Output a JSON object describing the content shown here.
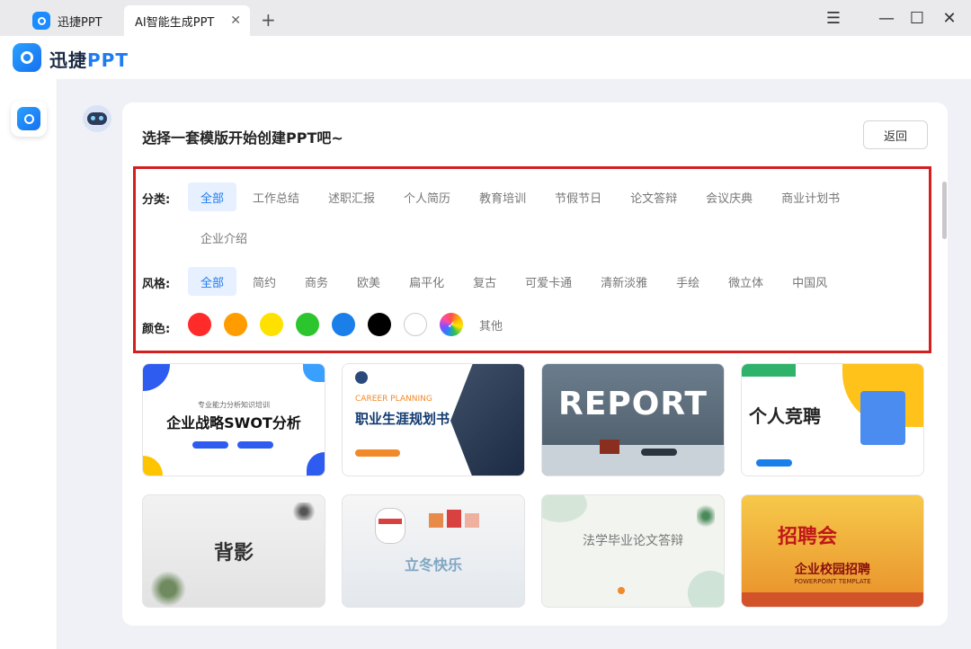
{
  "tabs": [
    {
      "label": "迅捷PPT"
    },
    {
      "label": "AI智能生成PPT"
    }
  ],
  "window_controls": {
    "menu": "☰",
    "minimize": "—",
    "maximize": "☐",
    "close": "✕"
  },
  "brand": {
    "name_prefix": "迅捷",
    "name_accent": "PPT"
  },
  "panel": {
    "title": "选择一套模版开始创建PPT吧~",
    "back_label": "返回"
  },
  "filters": {
    "category_label": "分类:",
    "categories": [
      "全部",
      "工作总结",
      "述职汇报",
      "个人简历",
      "教育培训",
      "节假节日",
      "论文答辩",
      "会议庆典",
      "商业计划书",
      "企业介绍"
    ],
    "style_label": "风格:",
    "styles": [
      "全部",
      "简约",
      "商务",
      "欧美",
      "扁平化",
      "复古",
      "可爱卡通",
      "清新淡雅",
      "手绘",
      "微立体",
      "中国风"
    ],
    "color_label": "颜色:",
    "colors": [
      "#ff2a2a",
      "#ff9d00",
      "#ffe100",
      "#2dc52d",
      "#1a7fe8",
      "#000000",
      "#ffffff"
    ],
    "other_label": "其他"
  },
  "templates": [
    {
      "title": "企业战略SWOT分析",
      "subtitle": "专业能力分析知识培训"
    },
    {
      "title": "职业生涯规划书",
      "subtitle": "CAREER PLANNING"
    },
    {
      "title": "REPORT"
    },
    {
      "title": "个人竞聘"
    },
    {
      "title": "背影"
    },
    {
      "title": "立冬快乐"
    },
    {
      "title": "法学毕业论文答辩"
    },
    {
      "title": "企业校园招聘",
      "subtitle": "POWERPOINT TEMPLATE"
    }
  ]
}
